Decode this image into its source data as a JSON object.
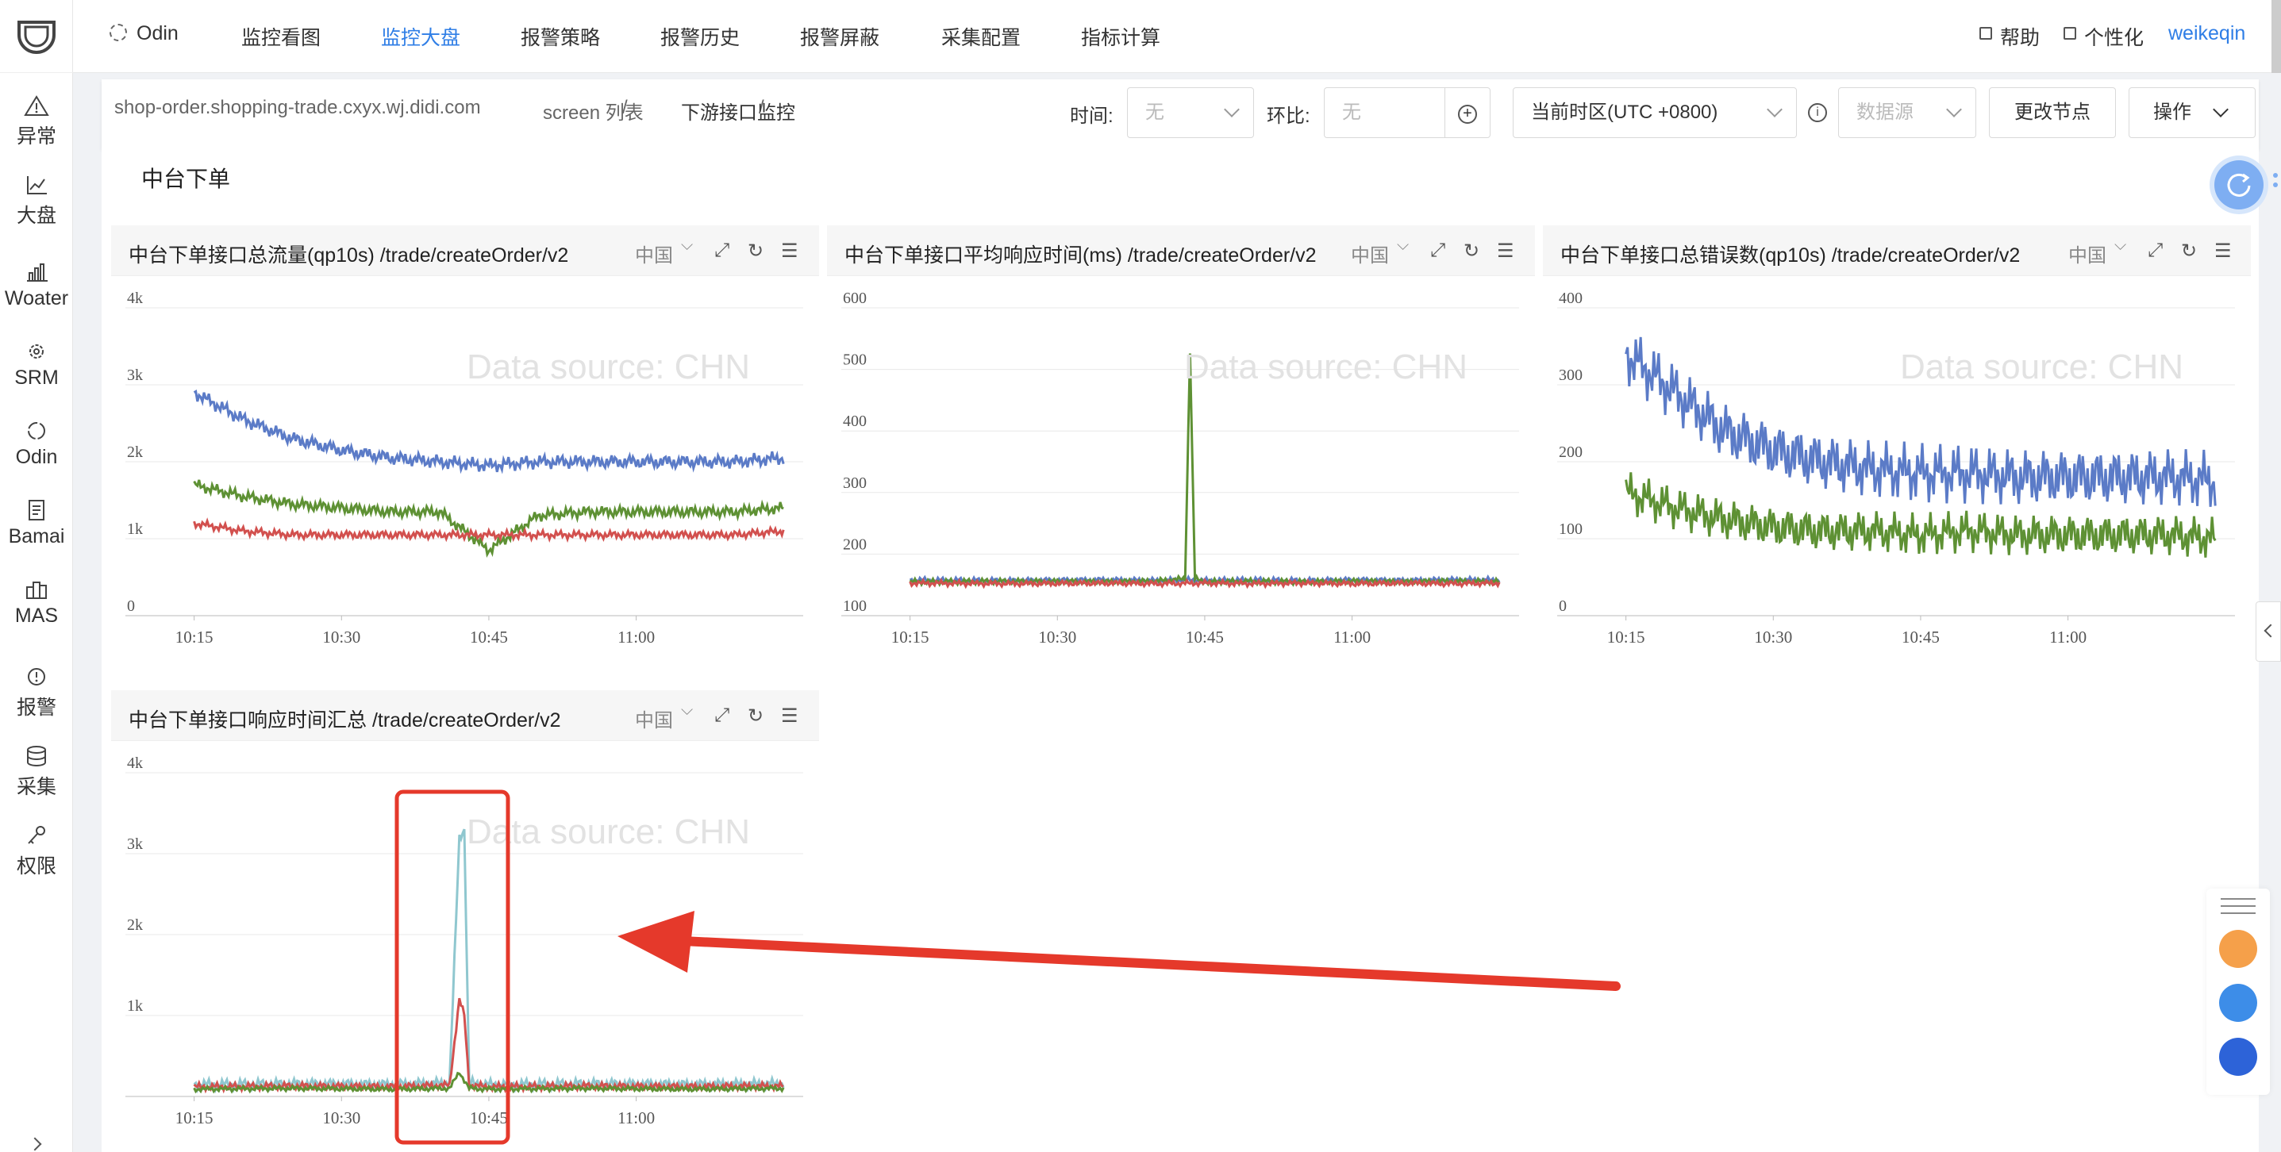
{
  "sidebar": {
    "items": [
      {
        "label": "异常",
        "icon": "warning-icon"
      },
      {
        "label": "大盘",
        "icon": "line-chart-icon"
      },
      {
        "label": "Woater",
        "icon": "bar-chart-icon"
      },
      {
        "label": "SRM",
        "icon": "gear-icon"
      },
      {
        "label": "Odin",
        "icon": "odin-icon"
      },
      {
        "label": "Bamai",
        "icon": "document-icon"
      },
      {
        "label": "MAS",
        "icon": "building-icon"
      },
      {
        "label": "报警",
        "icon": "alert-icon"
      },
      {
        "label": "采集",
        "icon": "database-icon"
      },
      {
        "label": "权限",
        "icon": "key-icon"
      }
    ]
  },
  "topnav": {
    "brand": "Odin",
    "items": [
      "监控看图",
      "监控大盘",
      "报警策略",
      "报警历史",
      "报警屏蔽",
      "采集配置",
      "指标计算"
    ],
    "active": "监控大盘",
    "help": "帮助",
    "personalize": "个性化",
    "user": "weikeqin"
  },
  "breadcrumb": {
    "items": [
      "shop-order.shopping-trade.cxyx.wj.didi.com",
      "screen 列表",
      "下游接口监控"
    ],
    "separator": "/"
  },
  "controls": {
    "time_label": "时间:",
    "time_value": "无",
    "compare_label": "环比:",
    "compare_placeholder": "无",
    "timezone": "当前时区(UTC +0800)",
    "datasource_placeholder": "数据源",
    "change_node": "更改节点",
    "operation": "操作"
  },
  "section_title": "中台下单",
  "panels": [
    {
      "title": "中台下单接口总流量(qp10s) /trade/createOrder/v2",
      "region": "中国",
      "watermark": "Data source: CHN"
    },
    {
      "title": "中台下单接口平均响应时间(ms) /trade/createOrder/v2",
      "region": "中国",
      "watermark": "Data source: CHN"
    },
    {
      "title": "中台下单接口总错误数(qp10s) /trade/createOrder/v2",
      "region": "中国",
      "watermark": "Data source: CHN"
    },
    {
      "title": "中台下单接口响应时间汇总 /trade/createOrder/v2",
      "region": "中国",
      "watermark": "Data source: CHN"
    }
  ],
  "colors": {
    "accent": "#2f7ee6",
    "blue": "#5b7bc7",
    "green": "#5e9134",
    "red": "#d2504e",
    "cyan": "#8fc7cf",
    "highlight": "#e5392b"
  },
  "chart_data": [
    {
      "type": "line",
      "x_ticks": [
        "10:15",
        "10:30",
        "10:45",
        "11:00"
      ],
      "y_ticks": [
        "0",
        "1k",
        "2k",
        "3k",
        "4k"
      ],
      "ylim": [
        0,
        4000
      ],
      "series": [
        {
          "x": [
            0,
            5,
            10,
            15,
            20,
            25,
            30,
            35,
            40,
            45,
            50,
            55,
            60
          ],
          "values": [
            2900,
            2550,
            2300,
            2150,
            2050,
            2000,
            1950,
            2000,
            2000,
            2000,
            2000,
            2000,
            2050
          ]
        },
        {
          "x": [
            0,
            5,
            10,
            15,
            20,
            25,
            30,
            35,
            40,
            45,
            50,
            55,
            60
          ],
          "values": [
            1700,
            1550,
            1450,
            1400,
            1350,
            1350,
            850,
            1300,
            1350,
            1350,
            1350,
            1350,
            1400
          ]
        },
        {
          "x": [
            0,
            5,
            10,
            15,
            20,
            25,
            30,
            35,
            40,
            45,
            50,
            55,
            60
          ],
          "values": [
            1200,
            1100,
            1050,
            1050,
            1050,
            1050,
            1050,
            1050,
            1050,
            1050,
            1050,
            1050,
            1100
          ]
        }
      ]
    },
    {
      "type": "line",
      "x_ticks": [
        "10:15",
        "10:30",
        "10:45",
        "11:00"
      ],
      "y_ticks": [
        "100",
        "200",
        "300",
        "400",
        "500",
        "600"
      ],
      "ylim": [
        100,
        600
      ],
      "series": [
        {
          "x": [
            0,
            10,
            20,
            25,
            28,
            30,
            35,
            40,
            45,
            50,
            55,
            60
          ],
          "values": [
            158,
            157,
            158,
            157,
            158,
            157,
            158,
            157,
            158,
            157,
            158,
            158
          ]
        },
        {
          "x": [
            0,
            10,
            20,
            25,
            28,
            28.5,
            29,
            30,
            35,
            40,
            45,
            50,
            55,
            60
          ],
          "values": [
            155,
            156,
            155,
            156,
            160,
            530,
            160,
            155,
            156,
            155,
            156,
            155,
            156,
            155
          ]
        },
        {
          "x": [
            0,
            10,
            20,
            25,
            30,
            35,
            40,
            45,
            50,
            55,
            60
          ],
          "values": [
            153,
            152,
            153,
            152,
            153,
            152,
            153,
            152,
            153,
            152,
            153
          ]
        }
      ]
    },
    {
      "type": "line",
      "x_ticks": [
        "10:15",
        "10:30",
        "10:45",
        "11:00"
      ],
      "y_ticks": [
        "0",
        "100",
        "200",
        "300",
        "400"
      ],
      "ylim": [
        0,
        400
      ],
      "series": [
        {
          "x": [
            0,
            5,
            10,
            15,
            20,
            25,
            30,
            35,
            40,
            45,
            50,
            55,
            60
          ],
          "values": [
            340,
            290,
            240,
            215,
            200,
            190,
            185,
            185,
            180,
            180,
            180,
            180,
            175
          ]
        },
        {
          "x": [
            0,
            5,
            10,
            15,
            20,
            25,
            30,
            35,
            40,
            45,
            50,
            55,
            60
          ],
          "values": [
            160,
            140,
            125,
            115,
            110,
            110,
            105,
            110,
            105,
            105,
            105,
            105,
            100
          ]
        }
      ]
    },
    {
      "type": "line",
      "x_ticks": [
        "10:15",
        "10:30",
        "10:45",
        "11:00"
      ],
      "y_ticks": [
        "1k",
        "2k",
        "3k",
        "4k"
      ],
      "ylim": [
        0,
        4000
      ],
      "series": [
        {
          "x": [
            0,
            10,
            20,
            26,
            27,
            27.5,
            28,
            30,
            40,
            50,
            60
          ],
          "values": [
            150,
            160,
            150,
            170,
            3200,
            3300,
            170,
            150,
            160,
            150,
            160
          ]
        },
        {
          "x": [
            0,
            10,
            20,
            26,
            27,
            27.5,
            28,
            30,
            40,
            50,
            60
          ],
          "values": [
            120,
            130,
            120,
            140,
            1200,
            1000,
            140,
            120,
            130,
            120,
            130
          ]
        },
        {
          "x": [
            0,
            10,
            20,
            26,
            27,
            28,
            30,
            40,
            50,
            60
          ],
          "values": [
            90,
            100,
            90,
            100,
            300,
            100,
            90,
            100,
            90,
            100
          ]
        }
      ]
    }
  ]
}
